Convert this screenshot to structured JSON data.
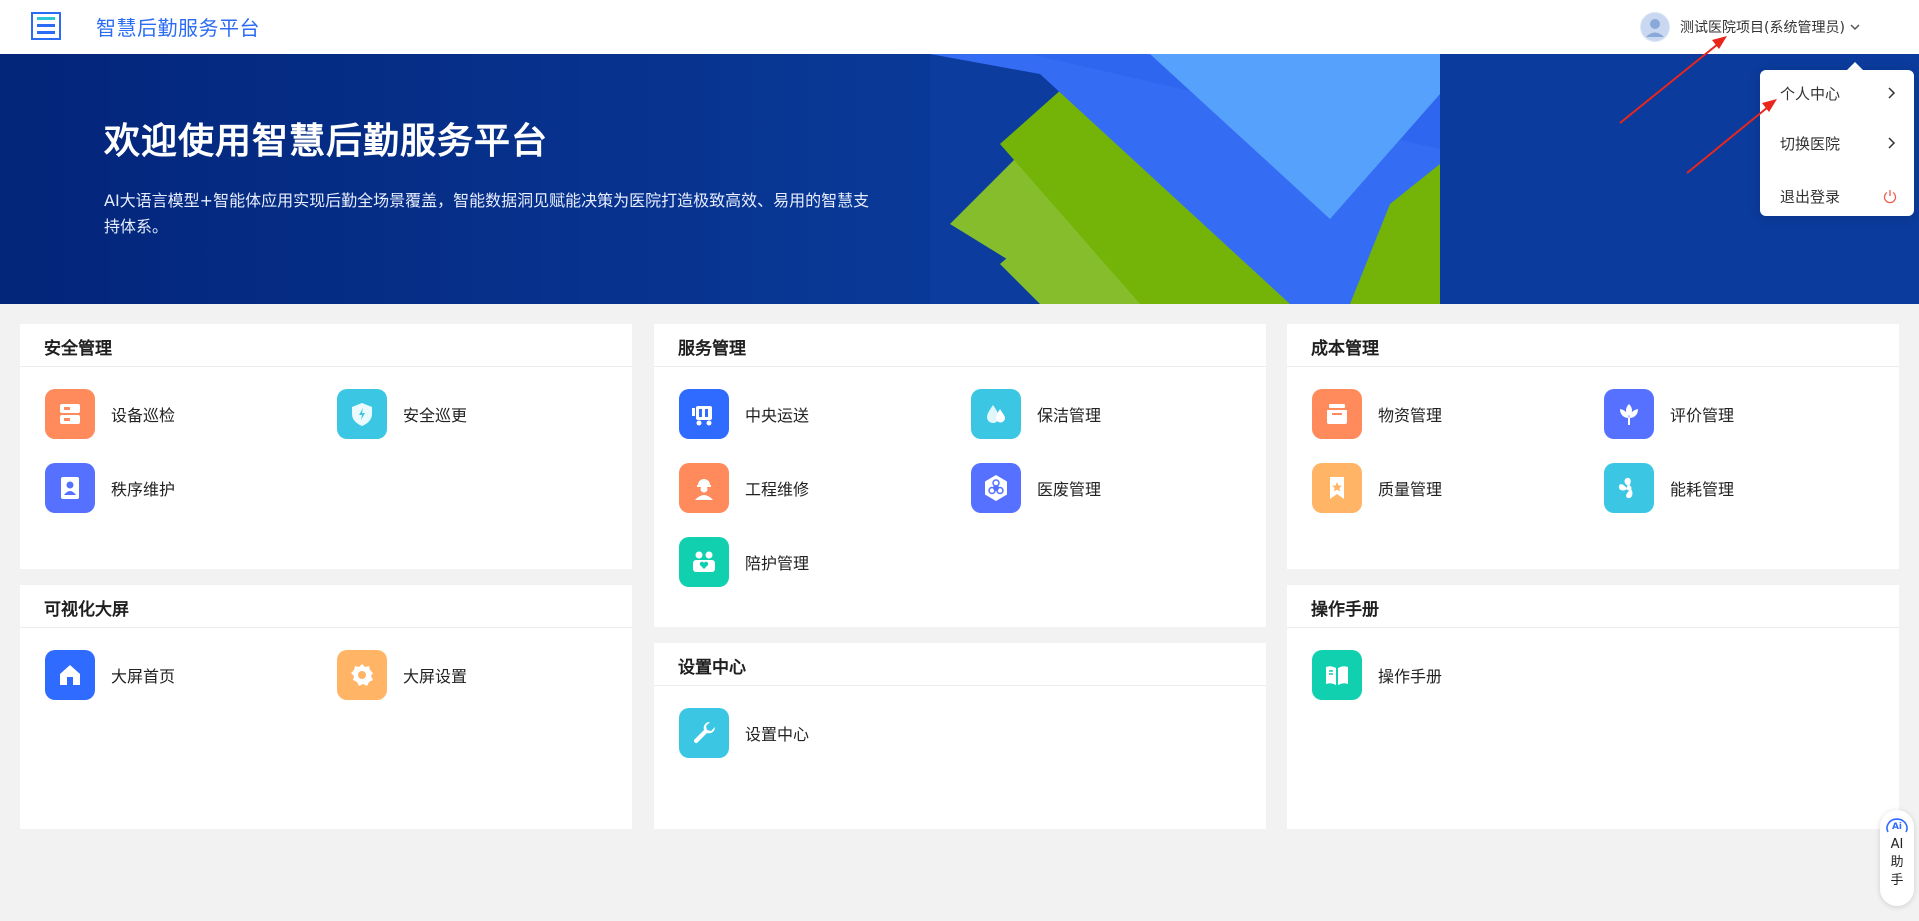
{
  "header": {
    "title": "智慧后勤服务平台",
    "user_name": "测试医院项目(系统管理员)"
  },
  "banner": {
    "title": "欢迎使用智慧后勤服务平台",
    "description": "AI大语言模型+智能体应用实现后勤全场景覆盖，智能数据洞见赋能决策为医院打造极致高效、易用的智慧支持体系。"
  },
  "cards": {
    "security": {
      "title": "安全管理",
      "items": [
        "设备巡检",
        "安全巡更",
        "秩序维护"
      ]
    },
    "visual": {
      "title": "可视化大屏",
      "items": [
        "大屏首页",
        "大屏设置"
      ]
    },
    "service": {
      "title": "服务管理",
      "items": [
        "中央运送",
        "保洁管理",
        "工程维修",
        "医废管理",
        "陪护管理"
      ]
    },
    "settings": {
      "title": "设置中心",
      "items": [
        "设置中心"
      ]
    },
    "cost": {
      "title": "成本管理",
      "items": [
        "物资管理",
        "评价管理",
        "质量管理",
        "能耗管理"
      ]
    },
    "manual": {
      "title": "操作手册",
      "items": [
        "操作手册"
      ]
    }
  },
  "dropdown": {
    "items": [
      "个人中心",
      "切换医院",
      "退出登录"
    ]
  },
  "ai_helper": {
    "label": "AI助手",
    "icon_text": "Ai"
  },
  "colors": {
    "brand": "#2b6cf5",
    "orange": "#ff8a5b",
    "cyan": "#3bc7e4",
    "indigo": "#5671ff",
    "blue": "#2f6bff",
    "teal": "#10d0b0",
    "peach": "#ffb466",
    "annotation_arrow": "#e8261c"
  },
  "icons": {
    "logo": "document-list-icon",
    "dropdown_chevron": "chevron-down-icon",
    "menu_arrow": "chevron-right-icon",
    "logout": "power-icon"
  }
}
